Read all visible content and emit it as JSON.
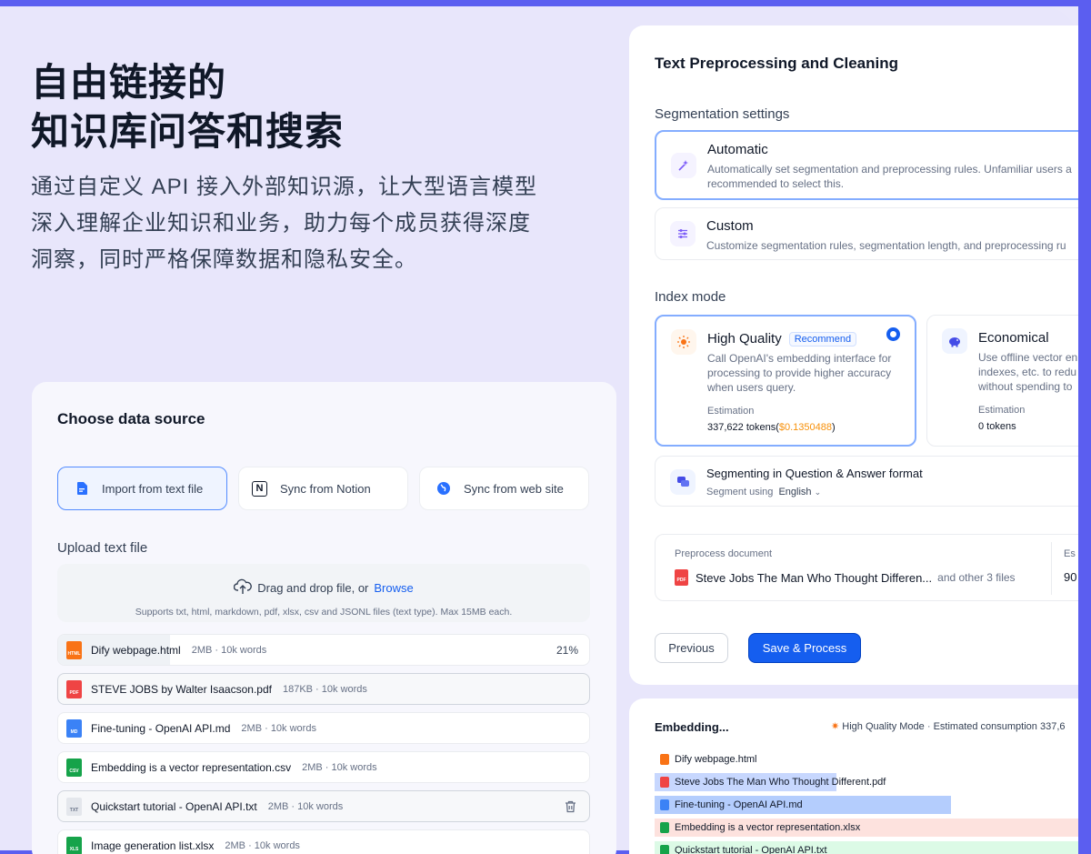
{
  "hero": {
    "title_line1": "自由链接的",
    "title_line2": "知识库问答和搜索",
    "description": "通过自定义 API 接入外部知识源，让大型语言模型深入理解企业知识和业务，助力每个成员获得深度洞察，同时严格保障数据和隐私安全。"
  },
  "data_source": {
    "title": "Choose data source",
    "sources": [
      {
        "label": "Import from text file",
        "icon": "file-text-icon",
        "active": true
      },
      {
        "label": "Sync from Notion",
        "icon": "notion-icon",
        "active": false
      },
      {
        "label": "Sync from web site",
        "icon": "globe-icon",
        "active": false
      }
    ],
    "upload_label": "Upload text file",
    "dropzone": {
      "text": "Drag and drop file, or",
      "browse": "Browse",
      "hint": "Supports txt, html, markdown, pdf, xlsx, csv and JSONL files (text type). Max 15MB each."
    },
    "files": [
      {
        "name": "Dify webpage.html",
        "meta": "2MB · 10k words",
        "progress": "21%",
        "type": "HTML",
        "color": "#f97316"
      },
      {
        "name": "STEVE JOBS by Walter Isaacson.pdf",
        "meta": "187KB · 10k words",
        "type": "PDF",
        "color": "#ef4444"
      },
      {
        "name": "Fine-tuning - OpenAI API.md",
        "meta": "2MB · 10k words",
        "type": "MD",
        "color": "#3b82f6"
      },
      {
        "name": "Embedding is a vector representation.csv",
        "meta": "2MB · 10k words",
        "type": "CSV",
        "color": "#16a34a"
      },
      {
        "name": "Quickstart tutorial - OpenAI API.txt",
        "meta": "2MB · 10k words",
        "type": "TXT",
        "color": "#d0d5dd"
      },
      {
        "name": "Image generation list.xlsx",
        "meta": "2MB · 10k words",
        "type": "XLSX",
        "color": "#16a34a"
      }
    ]
  },
  "preprocess": {
    "title": "Text Preprocessing and Cleaning",
    "segmentation_label": "Segmentation settings",
    "automatic": {
      "title": "Automatic",
      "desc1": "Automatically set segmentation and preprocessing rules. Unfamiliar users a",
      "desc2": "recommended to select this."
    },
    "custom": {
      "title": "Custom",
      "desc": "Customize segmentation rules, segmentation length, and preprocessing ru"
    },
    "index_label": "Index mode",
    "high_quality": {
      "title": "High Quality",
      "badge": "Recommend",
      "desc": "Call OpenAI's embedding interface for processing to provide higher accuracy when users query.",
      "est_label": "Estimation",
      "tokens": "337,622 tokens(",
      "cost": "$0.1350488",
      "close": ")"
    },
    "economical": {
      "title": "Economical",
      "desc": "Use offline vector en indexes, etc. to redu without spending to",
      "est_label": "Estimation",
      "tokens": "0 tokens"
    },
    "qa": {
      "title": "Segmenting in Question & Answer format",
      "segment_using": "Segment using",
      "language": "English"
    },
    "preprocess_doc": {
      "label": "Preprocess document",
      "file": "Steve Jobs The Man Who Thought Differen...",
      "others": "and other 3 files",
      "est_label": "Es",
      "est_value": "90"
    },
    "buttons": {
      "previous": "Previous",
      "save": "Save & Process"
    }
  },
  "embedding": {
    "title": "Embedding...",
    "mode": "High Quality Mode",
    "consumption": "Estimated consumption 337,6",
    "rows": [
      {
        "name": "Dify webpage.html",
        "color": "#f97316",
        "bar": "",
        "fill": 0
      },
      {
        "name": "Steve Jobs The Man Who Thought Different.pdf",
        "color": "#ef4444",
        "bar": "#c7d7fe",
        "fill": 0.43
      },
      {
        "name": "Fine-tuning - OpenAI API.md",
        "color": "#3b82f6",
        "bar": "#b4cdfd",
        "fill": 0.7
      },
      {
        "name": "Embedding is a vector representation.xlsx",
        "color": "#16a34a",
        "bar": "#fde2de",
        "fill": 1
      },
      {
        "name": "Quickstart tutorial - OpenAI API.txt",
        "color": "#16a34a",
        "bar": "#dcfae6",
        "fill": 1
      }
    ]
  }
}
